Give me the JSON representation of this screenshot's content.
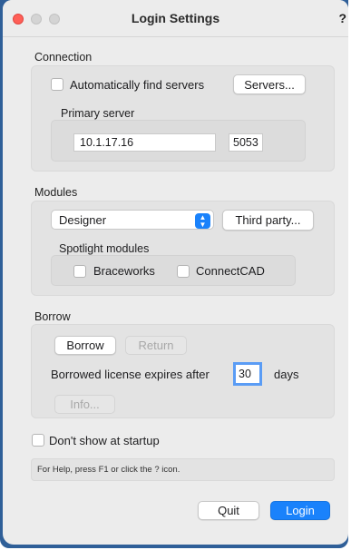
{
  "window": {
    "title": "Login Settings",
    "help_glyph": "?"
  },
  "connection": {
    "section_label": "Connection",
    "auto_find_label": "Automatically find servers",
    "auto_find_checked": false,
    "servers_button": "Servers...",
    "primary_server_label": "Primary server",
    "server_address": "10.1.17.16",
    "server_port": "5053"
  },
  "modules": {
    "section_label": "Modules",
    "selected_module": "Designer",
    "third_party_button": "Third party...",
    "spotlight_label": "Spotlight modules",
    "braceworks_label": "Braceworks",
    "connectcad_label": "ConnectCAD"
  },
  "borrow": {
    "section_label": "Borrow",
    "borrow_button": "Borrow",
    "return_button": "Return",
    "expires_label": "Borrowed license expires after",
    "days_value": "30",
    "days_label": "days",
    "info_button": "Info..."
  },
  "startup": {
    "dont_show_label": "Don't show at startup"
  },
  "help_text": "For Help, press F1 or click the ? icon.",
  "actions": {
    "quit_button": "Quit",
    "login_button": "Login"
  },
  "colors": {
    "accent": "#1a82fb",
    "close": "#ff5f57",
    "background": "#ececec"
  }
}
